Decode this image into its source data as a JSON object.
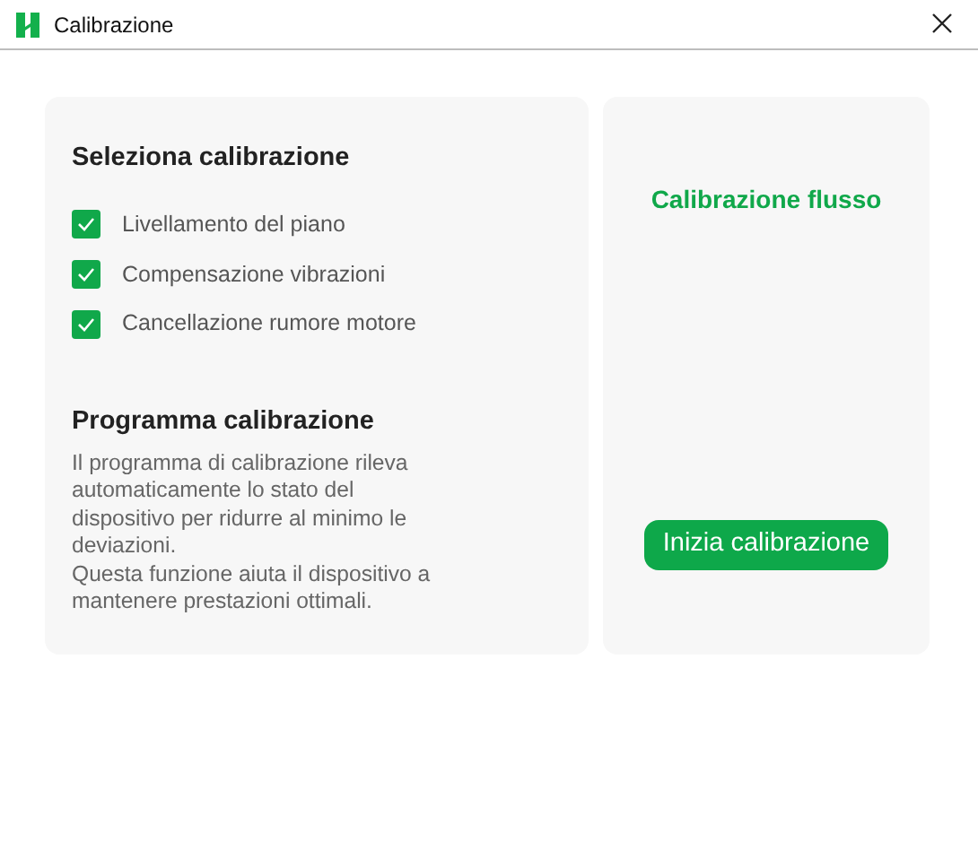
{
  "window": {
    "title": "Calibrazione"
  },
  "select_section": {
    "title": "Seleziona calibrazione",
    "options": [
      {
        "label": "Livellamento del piano",
        "checked": true
      },
      {
        "label": "Compensazione vibrazioni",
        "checked": true
      },
      {
        "label": "Cancellazione rumore motore",
        "checked": true
      }
    ]
  },
  "program_section": {
    "title": "Programma calibrazione",
    "paragraphs": [
      "Il programma di calibrazione rileva automaticamente lo stato del dispositivo per ridurre al minimo le deviazioni.",
      "Questa funzione aiuta il dispositivo a mantenere prestazioni ottimali."
    ]
  },
  "side_panel": {
    "title": "Calibrazione flusso",
    "button": "Inizia calibrazione"
  }
}
